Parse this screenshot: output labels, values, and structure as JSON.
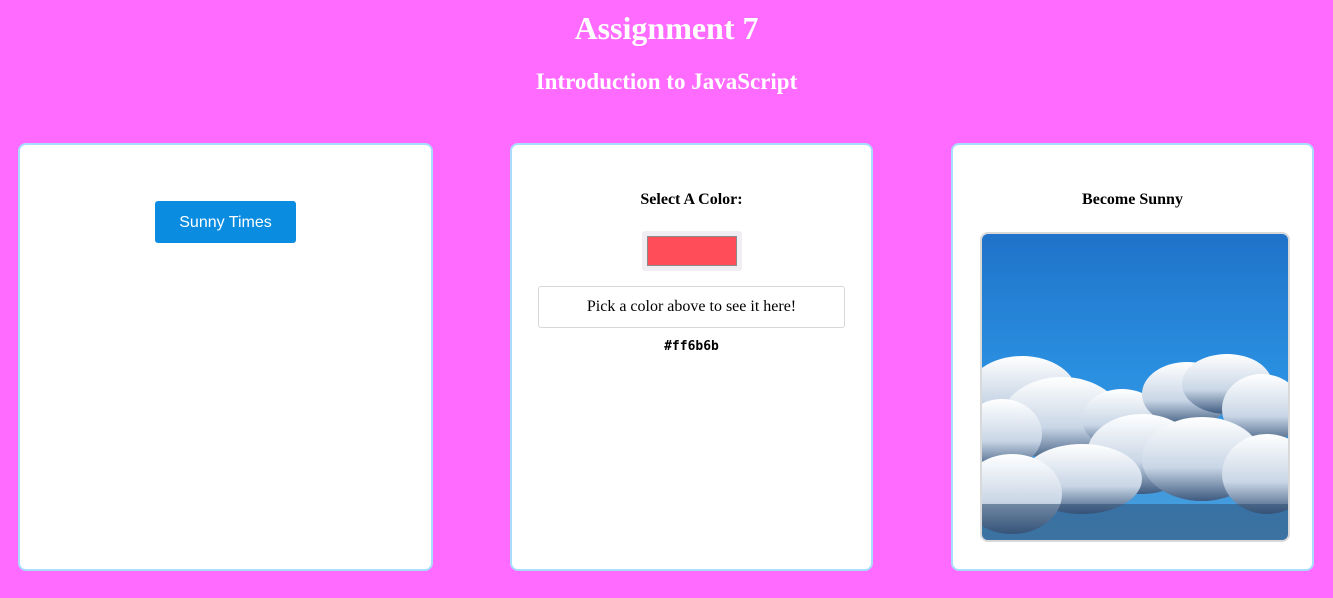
{
  "header": {
    "title": "Assignment 7",
    "subtitle": "Introduction to JavaScript"
  },
  "cards": {
    "sunny": {
      "button_label": "Sunny Times"
    },
    "color_picker": {
      "label": "Select A Color:",
      "selected_color": "#ff4d5a",
      "display_text": "Pick a color above to see it here!",
      "hex_text": "#ff6b6b"
    },
    "become_sunny": {
      "label": "Become Sunny",
      "image_icon": "sky-clouds-image"
    }
  },
  "colors": {
    "page_background": "#ff6bff",
    "card_border": "#a9dcff",
    "button_blue": "#0a8ce0"
  }
}
